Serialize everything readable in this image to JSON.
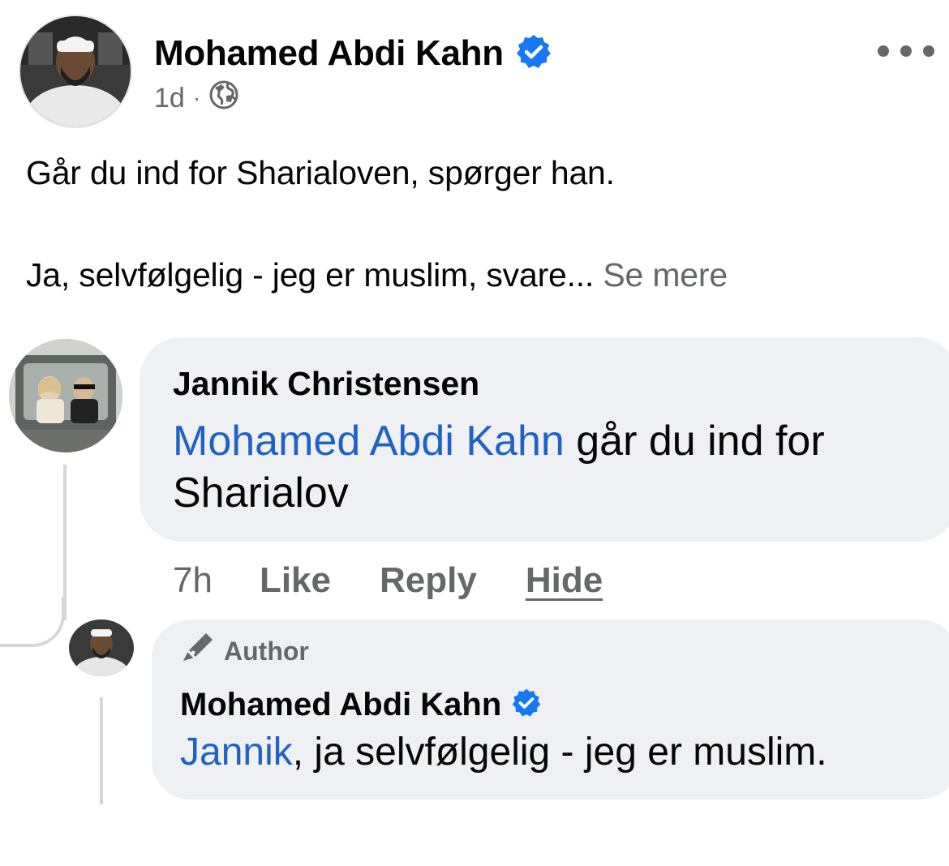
{
  "post": {
    "author": {
      "name": "Mohamed Abdi Kahn",
      "verified": true,
      "avatar_icon": "profile-photo"
    },
    "meta": {
      "time": "1d",
      "separator": "·",
      "audience_icon": "globe-icon"
    },
    "more_icon": "ellipsis-icon",
    "text_line1": "Går du ind for Sharialoven, spørger han.",
    "text_line2": "Ja, selvfølgelig - jeg er muslim, svare...",
    "see_more_label": "Se mere"
  },
  "comments": [
    {
      "author": "Jannik Christensen",
      "mention": "Mohamed Abdi Kahn",
      "text_rest_line1": " går du ind for",
      "text_line2": "Sharialov",
      "actions": {
        "time": "7h",
        "like": "Like",
        "reply": "Reply",
        "hide": "Hide"
      }
    },
    {
      "badge_label": "Author",
      "badge_icon": "pen-icon",
      "author": "Mohamed Abdi Kahn",
      "verified": true,
      "mention": "Jannik",
      "text_rest": ", ja selvfølgelig - jeg er muslim."
    }
  ],
  "colors": {
    "verified_blue": "#1877f2",
    "mention_blue": "#1f62c5",
    "secondary_text": "#65676b",
    "bubble_bg": "#eff0f3"
  }
}
